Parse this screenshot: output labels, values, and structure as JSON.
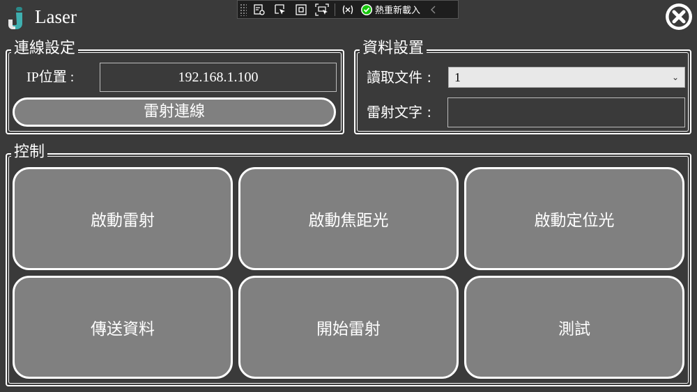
{
  "app": {
    "title": "Laser",
    "logo_icon": "app-logo-icon",
    "close_icon": "close-circle-icon"
  },
  "debug_toolbar": {
    "buttons": [
      {
        "name": "visual-tree-icon"
      },
      {
        "name": "select-element-icon"
      },
      {
        "name": "display-layout-adorners-icon"
      },
      {
        "name": "track-focused-element-icon"
      },
      {
        "name": "binding-failures-icon"
      }
    ],
    "hot_reload_label": "熱重新載入",
    "hot_reload_icon": "check-circle-icon",
    "collapse_icon": "chevron-left-icon"
  },
  "connection": {
    "title": "連線設定",
    "ip_label": "IP位置 :",
    "ip_value": "192.168.1.100",
    "connect_button": "雷射連線"
  },
  "data_settings": {
    "title": "資料設置",
    "read_file_label": "讀取文件 :",
    "read_file_value": "1",
    "laser_text_label": "雷射文字 :",
    "laser_text_value": ""
  },
  "control": {
    "title": "控制",
    "buttons": [
      {
        "label": "啟動雷射"
      },
      {
        "label": "啟動焦距光"
      },
      {
        "label": "啟動定位光"
      },
      {
        "label": "傳送資料"
      },
      {
        "label": "開始雷射"
      },
      {
        "label": "測試"
      }
    ]
  },
  "colors": {
    "background": "#3a3a3a",
    "button_fill": "#808080",
    "border": "#ffffff",
    "toolbar_bg": "#1e1e1e",
    "hot_reload_green": "#16c60c"
  }
}
